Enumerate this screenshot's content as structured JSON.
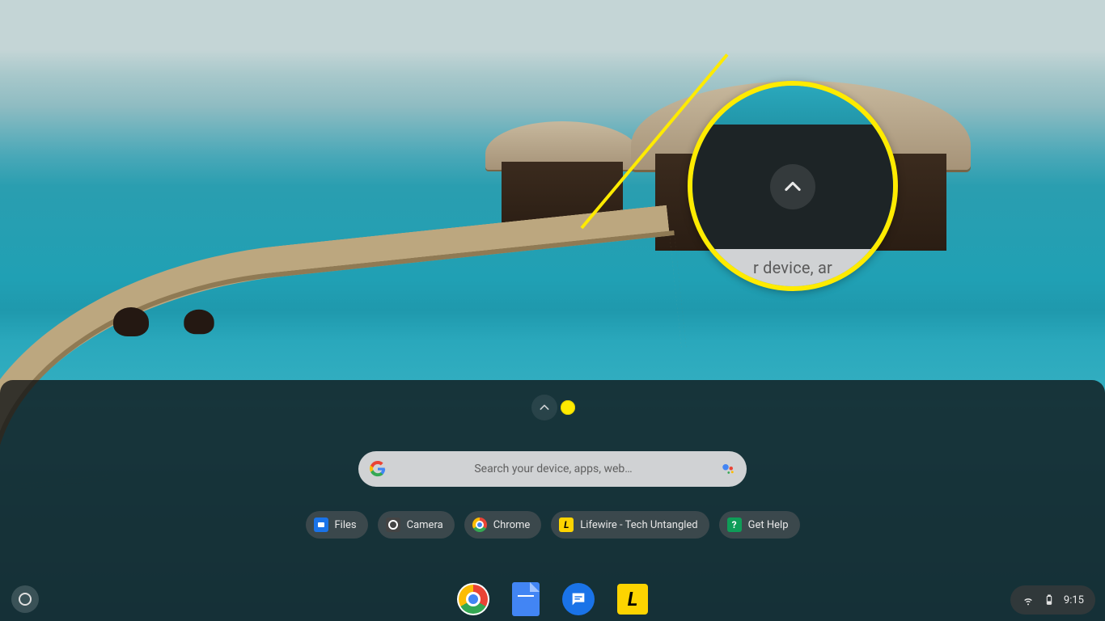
{
  "search": {
    "placeholder": "Search your device, apps, web…"
  },
  "chips": [
    {
      "icon": "files",
      "label": "Files"
    },
    {
      "icon": "camera",
      "label": "Camera"
    },
    {
      "icon": "chrome",
      "label": "Chrome"
    },
    {
      "icon": "lifewire",
      "label": "Lifewire - Tech Untangled"
    },
    {
      "icon": "help",
      "label": "Get Help"
    }
  ],
  "shelf_apps": [
    {
      "name": "Chrome"
    },
    {
      "name": "Docs"
    },
    {
      "name": "Messages"
    },
    {
      "name": "Lifewire"
    }
  ],
  "tray": {
    "time": "9:15"
  },
  "callout": {
    "search_fragment": "r device, ar"
  },
  "lifewire_glyph": "L"
}
